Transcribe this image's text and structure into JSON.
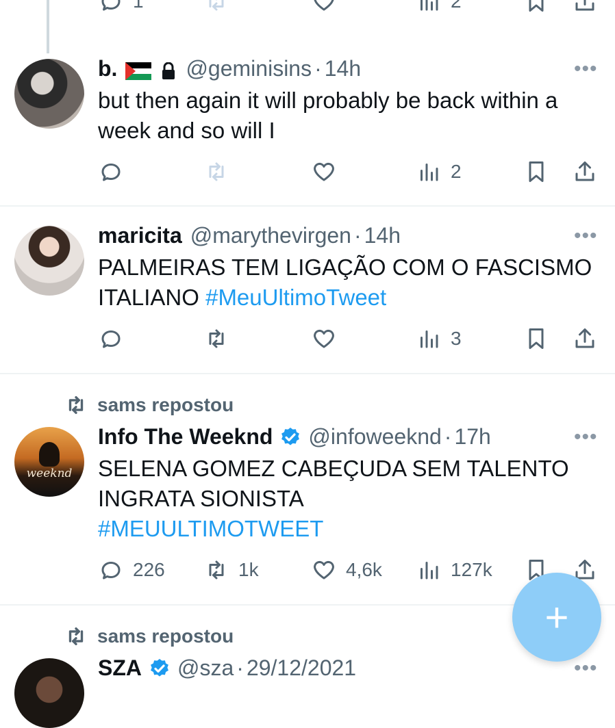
{
  "top_actions": {
    "reply_count": "1",
    "views_count": "2"
  },
  "tweets": [
    {
      "name": "b.",
      "handle": "@geminisins",
      "time": "14h",
      "text": "but then again it will probably be back within a week and so will I",
      "replies": "",
      "reposts": "",
      "likes": "",
      "views": "2"
    },
    {
      "name": "maricita",
      "handle": "@marythevirgen",
      "time": "14h",
      "text": "PALMEIRAS TEM LIGAÇÃO COM O FASCISMO ITALIANO",
      "hashtag": "#MeuUltimoTweet",
      "replies": "",
      "reposts": "",
      "likes": "",
      "views": "3"
    },
    {
      "reposted_by": "sams repostou",
      "name": "Info The Weeknd",
      "handle": "@infoweeknd",
      "time": "17h",
      "text_line1": "SELENA GOMEZ CABEÇUDA SEM TALENTO",
      "text_line2": "INGRATA SIONISTA",
      "hashtag": "#MEUULTIMOTWEET",
      "avatar_text": "weeknd",
      "replies": "226",
      "reposts": "1k",
      "likes": "4,6k",
      "views": "127k"
    },
    {
      "reposted_by": "sams repostou",
      "name": "SZA",
      "handle": "@sza",
      "time": "29/12/2021"
    }
  ],
  "more_label": "•••",
  "fab_label": "+",
  "colors": {
    "accent": "#1d9bf0",
    "fab": "#8ecdf8",
    "muted_text": "#536471"
  },
  "icons": [
    "reply-icon",
    "repost-icon",
    "like-icon",
    "views-icon",
    "bookmark-icon",
    "share-icon",
    "lock-icon",
    "verified-icon",
    "palestine-flag-icon",
    "plus-icon"
  ]
}
